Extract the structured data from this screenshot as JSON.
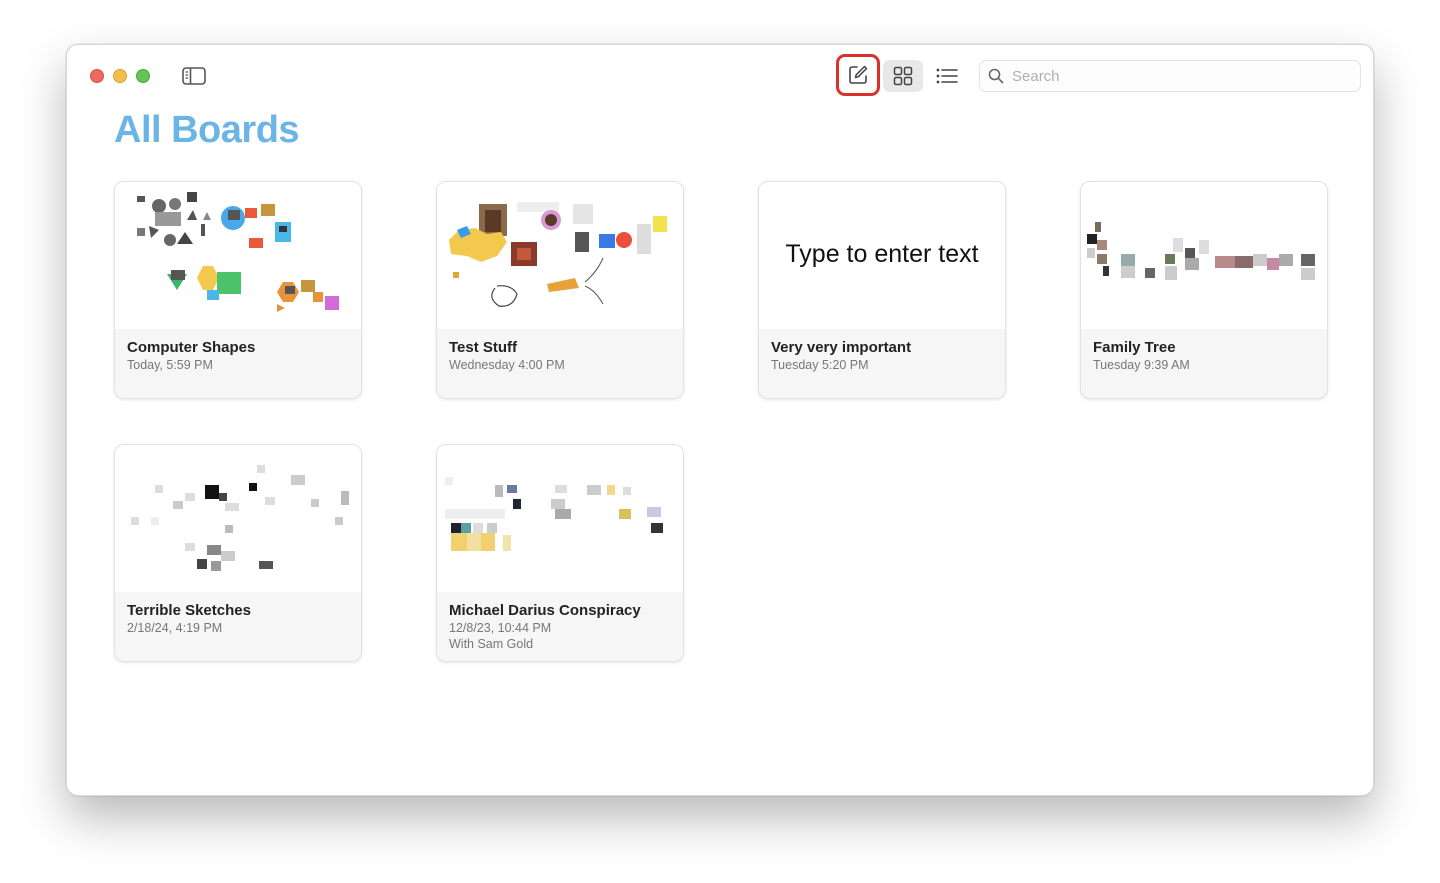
{
  "window": {
    "traffic_lights": {
      "close": "#ed6a5e",
      "minimize": "#f5bf4f",
      "zoom": "#62c554"
    }
  },
  "toolbar": {
    "sidebar_icon": "sidebar-icon",
    "compose_icon": "compose-icon",
    "grid_icon": "grid-view-icon",
    "list_icon": "list-view-icon",
    "highlight_color": "#d9322a"
  },
  "search": {
    "placeholder": "Search",
    "value": ""
  },
  "page": {
    "title": "All Boards",
    "title_color": "#6bb5e6"
  },
  "boards": [
    {
      "title": "Computer Shapes",
      "date": "Today, 5:59 PM",
      "shared": ""
    },
    {
      "title": "Test Stuff",
      "date": "Wednesday 4:00 PM",
      "shared": ""
    },
    {
      "title": "Very very important",
      "date": "Tuesday 5:20 PM",
      "shared": "",
      "thumb_text": "Type to enter text"
    },
    {
      "title": "Family Tree",
      "date": "Tuesday 9:39 AM",
      "shared": ""
    },
    {
      "title": "Terrible Sketches",
      "date": "2/18/24, 4:19 PM",
      "shared": ""
    },
    {
      "title": "Michael Darius Conspiracy",
      "date": "12/8/23, 10:44 PM",
      "shared": "With Sam Gold"
    }
  ]
}
